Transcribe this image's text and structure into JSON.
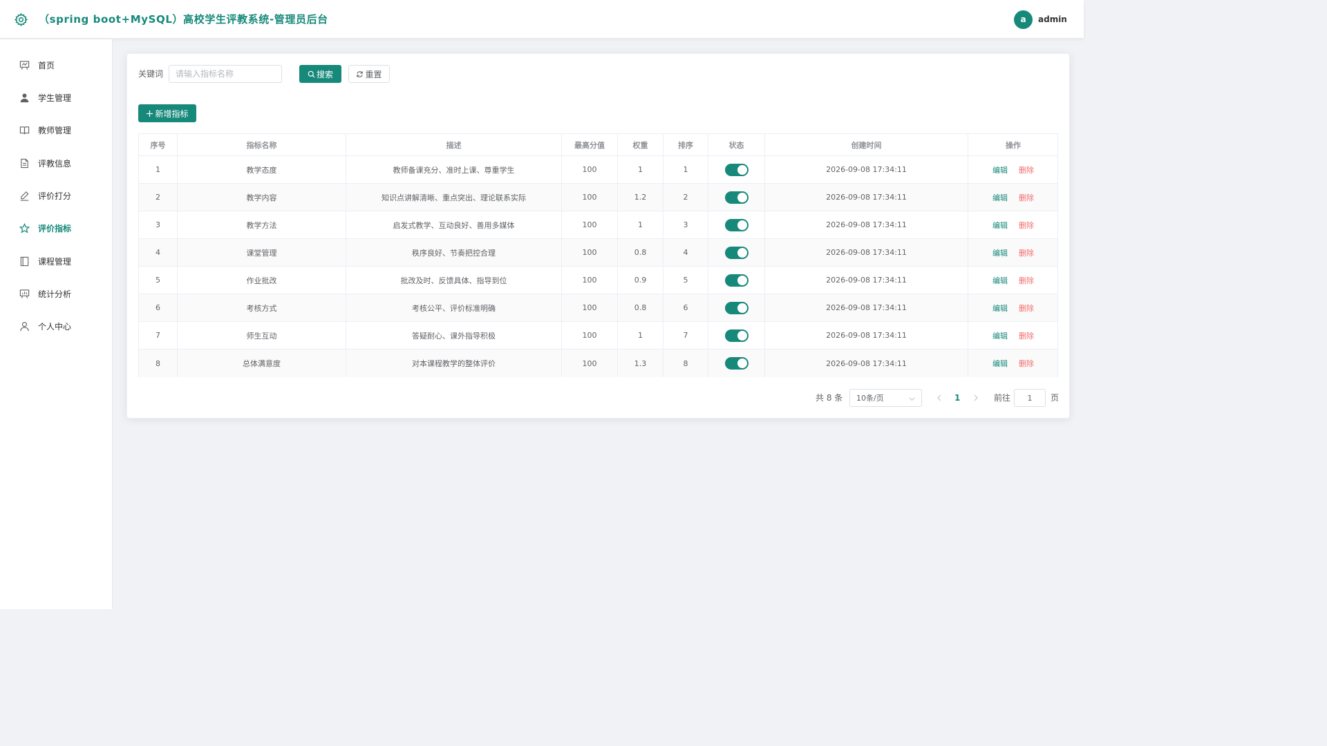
{
  "header": {
    "title": "（spring boot+MySQL）高校学生评教系统-管理员后台",
    "avatar_letter": "a",
    "username": "admin"
  },
  "sidebar": {
    "items": [
      {
        "label": "首页",
        "icon": "presentation-icon",
        "active": false
      },
      {
        "label": "学生管理",
        "icon": "user-icon",
        "active": false
      },
      {
        "label": "教师管理",
        "icon": "book-icon",
        "active": false
      },
      {
        "label": "评教信息",
        "icon": "document-icon",
        "active": false
      },
      {
        "label": "评价打分",
        "icon": "edit-icon",
        "active": false
      },
      {
        "label": "评价指标",
        "icon": "star-icon",
        "active": true
      },
      {
        "label": "课程管理",
        "icon": "notebook-icon",
        "active": false
      },
      {
        "label": "统计分析",
        "icon": "chart-board-icon",
        "active": false
      },
      {
        "label": "个人中心",
        "icon": "person-icon",
        "active": false
      }
    ]
  },
  "search": {
    "label": "关键词",
    "placeholder": "请输入指标名称",
    "value": "",
    "search_button": "搜索",
    "reset_button": "重置"
  },
  "toolbar": {
    "add_button": "新增指标"
  },
  "table": {
    "columns": [
      "序号",
      "指标名称",
      "描述",
      "最高分值",
      "权重",
      "排序",
      "状态",
      "创建时间",
      "操作"
    ],
    "edit_label": "编辑",
    "delete_label": "删除",
    "rows": [
      {
        "no": "1",
        "name": "教学态度",
        "desc": "教师备课充分、准时上课、尊重学生",
        "max": "100",
        "weight": "1",
        "order": "1",
        "enabled": true,
        "created": "2026-09-08 17:34:11"
      },
      {
        "no": "2",
        "name": "教学内容",
        "desc": "知识点讲解清晰、重点突出、理论联系实际",
        "max": "100",
        "weight": "1.2",
        "order": "2",
        "enabled": true,
        "created": "2026-09-08 17:34:11"
      },
      {
        "no": "3",
        "name": "教学方法",
        "desc": "启发式教学、互动良好、善用多媒体",
        "max": "100",
        "weight": "1",
        "order": "3",
        "enabled": true,
        "created": "2026-09-08 17:34:11"
      },
      {
        "no": "4",
        "name": "课堂管理",
        "desc": "秩序良好、节奏把控合理",
        "max": "100",
        "weight": "0.8",
        "order": "4",
        "enabled": true,
        "created": "2026-09-08 17:34:11"
      },
      {
        "no": "5",
        "name": "作业批改",
        "desc": "批改及时、反馈具体、指导到位",
        "max": "100",
        "weight": "0.9",
        "order": "5",
        "enabled": true,
        "created": "2026-09-08 17:34:11"
      },
      {
        "no": "6",
        "name": "考核方式",
        "desc": "考核公平、评价标准明确",
        "max": "100",
        "weight": "0.8",
        "order": "6",
        "enabled": true,
        "created": "2026-09-08 17:34:11"
      },
      {
        "no": "7",
        "name": "师生互动",
        "desc": "答疑耐心、课外指导积极",
        "max": "100",
        "weight": "1",
        "order": "7",
        "enabled": true,
        "created": "2026-09-08 17:34:11"
      },
      {
        "no": "8",
        "name": "总体满意度",
        "desc": "对本课程教学的整体评价",
        "max": "100",
        "weight": "1.3",
        "order": "8",
        "enabled": true,
        "created": "2026-09-08 17:34:11"
      }
    ]
  },
  "pagination": {
    "total_text": "共 8 条",
    "page_size": "10条/页",
    "current_page": "1",
    "goto_label": "前往",
    "goto_value": "1",
    "page_suffix": "页"
  },
  "colors": {
    "accent": "#16897a",
    "danger": "#f56c6c"
  }
}
